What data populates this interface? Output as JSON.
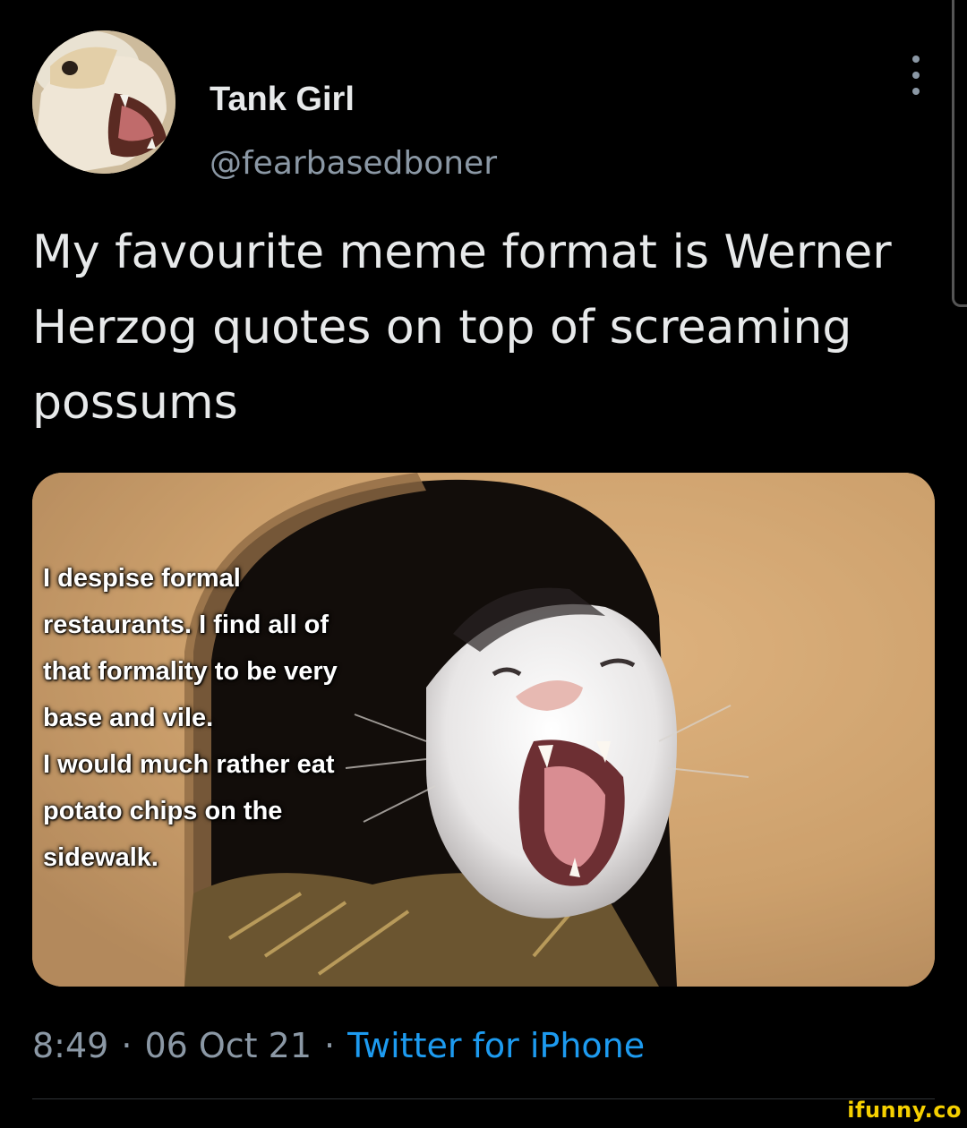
{
  "tweet": {
    "author": {
      "display_name": "Tank Girl",
      "handle": "@fearbasedboner"
    },
    "more_icon": "more-vertical-icon",
    "text": "My favourite meme format is Werner Herzog quotes on top of screaming possums",
    "media": {
      "quote_lines": [
        "I despise formal",
        "restaurants. I find all of",
        "that formality to be very",
        "base and vile.",
        "I would much rather eat",
        "potato chips on the",
        "sidewalk."
      ]
    },
    "time": "8:49",
    "separator": "·",
    "date": "06 Oct 21",
    "source": "Twitter for iPhone"
  },
  "watermark": "ifunny.co",
  "colors": {
    "background": "#000000",
    "primary_text": "#e7e9ea",
    "secondary_text": "#8b98a5",
    "link": "#1d9bf0",
    "watermark": "#f5d000"
  }
}
